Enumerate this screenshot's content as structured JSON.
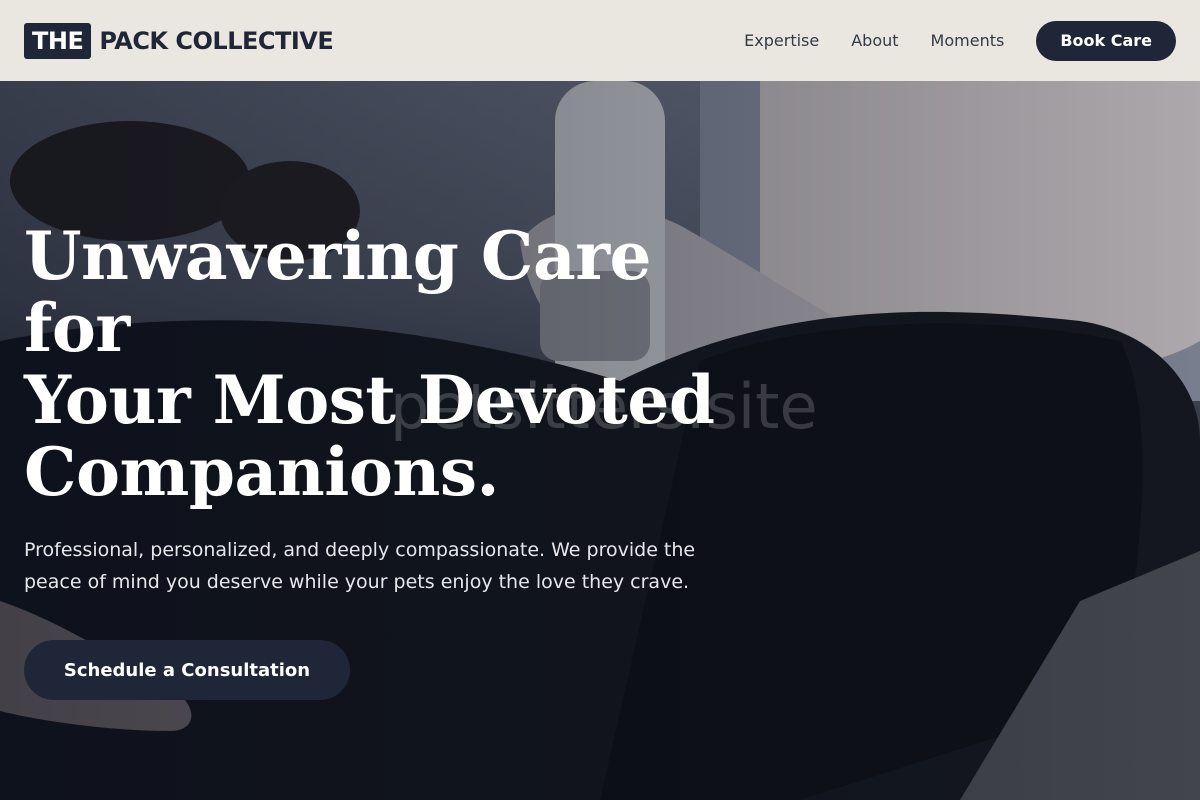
{
  "header": {
    "logo_mark": "THE",
    "logo_text": "PACK COLLECTIVE",
    "nav": [
      {
        "label": "Expertise"
      },
      {
        "label": "About"
      },
      {
        "label": "Moments"
      }
    ],
    "cta_label": "Book Care"
  },
  "hero": {
    "title_lines": [
      "Unwavering Care for",
      "Your Most Devoted",
      "Companions."
    ],
    "subtitle": "Professional, personalized, and deeply compassionate. We provide the peace of mind you deserve while your pets enjoy the love they crave.",
    "cta_label": "Schedule a Consultation",
    "watermark": "petsitters.site"
  },
  "colors": {
    "header_bg": "#e9e7df",
    "brand_dark": "#1f2638",
    "hero_text": "#ffffff"
  }
}
